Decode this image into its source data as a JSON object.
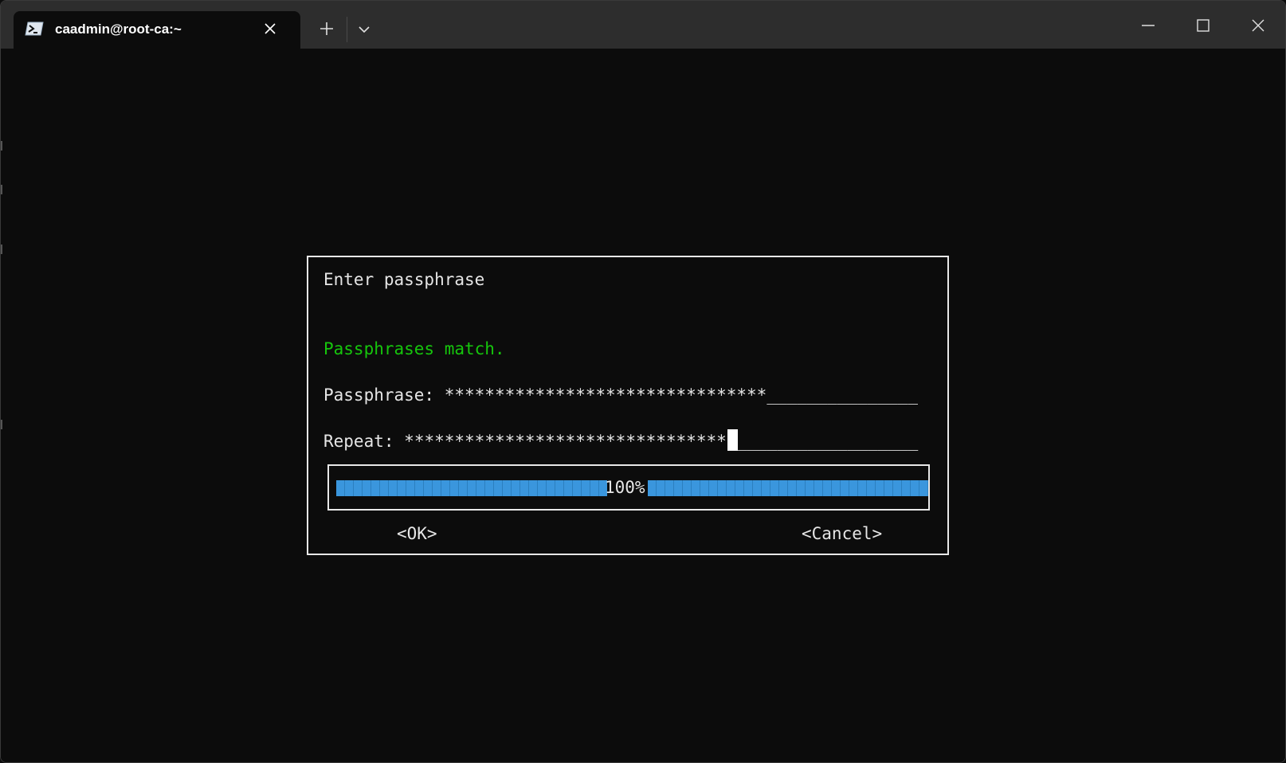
{
  "window": {
    "tab_title": "caadmin@root-ca:~",
    "tab_icon": "powershell-icon",
    "controls": [
      "minimize-icon",
      "maximize-icon",
      "close-icon"
    ]
  },
  "dialog": {
    "title": "Enter passphrase",
    "status": "Passphrases match.",
    "status_color": "#16c60c",
    "passphrase_label": "Passphrase:",
    "passphrase_value": "********************************",
    "passphrase_fill": "_______________",
    "repeat_label": "Repeat:",
    "repeat_value": "********************************",
    "repeat_fill": "__________________",
    "progress_text": "100%",
    "progress_color": "#3a96dd",
    "ok_label": "<OK>",
    "cancel_label": "<Cancel>"
  },
  "colors": {
    "background": "#0c0c0c",
    "titlebar": "#2d2d2d",
    "text": "#e6e6e6"
  }
}
